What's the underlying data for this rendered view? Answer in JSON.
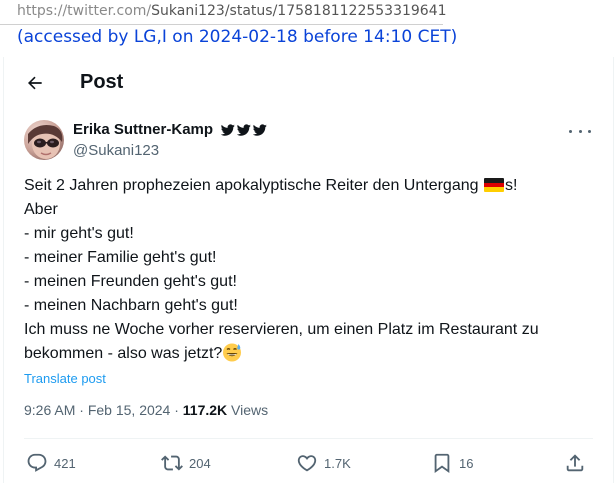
{
  "archive": {
    "url_prefix": "https://twitter.com/",
    "url_path": "Sukani123/status/1758181122553319641",
    "access_note": "(accessed by LG,I on 2024-02-18 before 14:10 CET)"
  },
  "header": {
    "title": "Post"
  },
  "author": {
    "name": "Erika Suttner-Kamp",
    "handle": "@Sukani123",
    "badge_icons": [
      "bird-icon",
      "bird-icon",
      "bird-icon"
    ]
  },
  "tweet": {
    "lines": [
      "Seit 2 Jahren prophezeien apokalyptische Reiter den Untergang",
      "s!",
      "Aber",
      "- mir geht's gut!",
      "- meiner Familie geht's gut!",
      "- meinen Freunden geht's gut!",
      "- meinen Nachbarn geht's gut!",
      "Ich muss ne Woche vorher reservieren, um einen Platz im Restaurant zu",
      "bekommen - also was jetzt?"
    ],
    "emoji_icons": [
      "german-flag-icon",
      "grinning-sweat-emoji-icon"
    ],
    "translate_label": "Translate post"
  },
  "meta": {
    "time": "9:26 AM",
    "separator": "·",
    "date": "Feb 15, 2024",
    "views_count": "117.2K",
    "views_label": " Views"
  },
  "actions": {
    "replies": "421",
    "reposts": "204",
    "likes": "1.7K",
    "bookmarks": "16"
  },
  "colors": {
    "accent": "#1d9bf0",
    "access_note": "#0a43d8",
    "secondary_text": "#536471",
    "primary_text": "#0f1419"
  }
}
